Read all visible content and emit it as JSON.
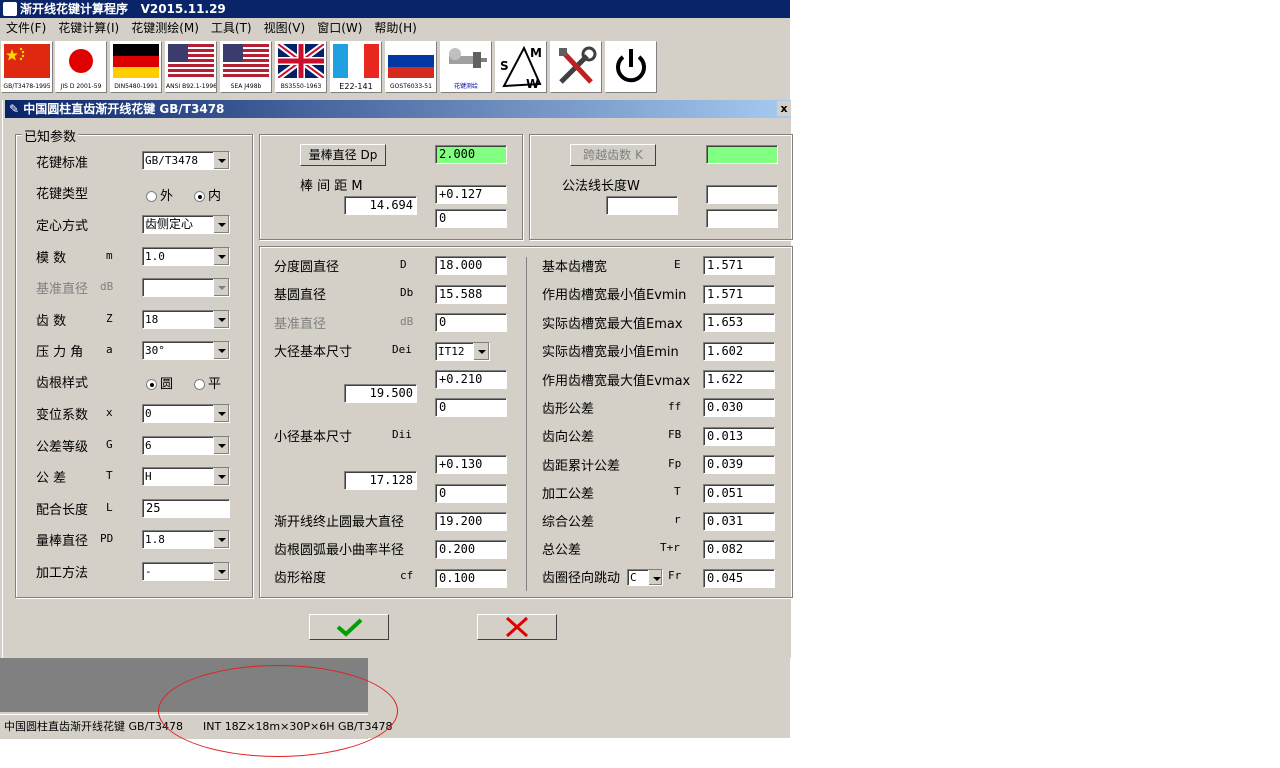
{
  "app": {
    "title": "渐开线花键计算程序",
    "version": "V2015.11.29"
  },
  "menu": [
    "文件(F)",
    "花键计算(I)",
    "花键测绘(M)",
    "工具(T)",
    "视图(V)",
    "窗口(W)",
    "帮助(H)"
  ],
  "toolbar": [
    {
      "icon": "china-flag-icon",
      "caption": "GB/T3478-1995"
    },
    {
      "icon": "japan-flag-icon",
      "caption": "JIS D 2001-59"
    },
    {
      "icon": "germany-flag-icon",
      "caption": "DIN5480-1991"
    },
    {
      "icon": "usa-flag-icon",
      "caption": "ANSI B92.1-1996"
    },
    {
      "icon": "usa-flag-icon",
      "caption": "SEA J498b"
    },
    {
      "icon": "uk-flag-icon",
      "caption": "BS3550-1963"
    },
    {
      "icon": "france-flag-icon",
      "caption": "E22-141"
    },
    {
      "icon": "russia-flag-icon",
      "caption": "GOST6033-51"
    },
    {
      "icon": "spline-measure-icon",
      "caption": "花键测绘"
    },
    {
      "icon": "smw-icon",
      "caption": ""
    },
    {
      "icon": "tools-icon",
      "caption": ""
    },
    {
      "icon": "power-icon",
      "caption": ""
    }
  ],
  "window": {
    "title": "中国圆柱直齿渐开线花键  GB/T3478",
    "close": "x"
  },
  "known": {
    "legend": "已知参数",
    "standard": {
      "label": "花键标准",
      "value": "GB/T3478"
    },
    "type": {
      "label": "花键类型",
      "opt1": "外",
      "opt2": "内",
      "selected": "内"
    },
    "centering": {
      "label": "定心方式",
      "value": "齿侧定心"
    },
    "module": {
      "label": "模    数",
      "sym": "m",
      "value": "1.0"
    },
    "base_dia": {
      "label": "基准直径",
      "sym": "dB",
      "value": ""
    },
    "teeth": {
      "label": "齿    数",
      "sym": "Z",
      "value": "18"
    },
    "pressure": {
      "label": "压 力 角",
      "sym": "a",
      "value": "30°"
    },
    "root": {
      "label": "齿根样式",
      "opt1": "圆",
      "opt2": "平",
      "selected": "圆"
    },
    "shift": {
      "label": "变位系数",
      "sym": "x",
      "value": "0"
    },
    "grade": {
      "label": "公差等级",
      "sym": "G",
      "value": "6"
    },
    "tolerance": {
      "label": "公    差",
      "sym": "T",
      "value": "H"
    },
    "length": {
      "label": "配合长度",
      "sym": "L",
      "value": "25"
    },
    "pin": {
      "label": "量棒直径",
      "sym": "PD",
      "value": "1.8"
    },
    "method": {
      "label": "加工方法",
      "value": "-"
    }
  },
  "pin_box": {
    "button": "量棒直径 Dp",
    "dp_value": "2.000",
    "distance_label": "棒 间 距  M",
    "m_value": "14.694",
    "upper": "+0.127",
    "lower": "0"
  },
  "span_box": {
    "button": "跨越齿数  K",
    "k_value": "",
    "w_label": "公法线长度W",
    "w_value": "",
    "upper": "",
    "lower": ""
  },
  "left_results": [
    {
      "label": "分度圆直径",
      "sym": "D",
      "value": "18.000"
    },
    {
      "label": "基圆直径",
      "sym": "Db",
      "value": "15.588"
    },
    {
      "label": "基准直径",
      "sym": "dB",
      "value": "0"
    }
  ],
  "major": {
    "label": "大径基本尺寸",
    "sym": "Dei",
    "grade": "IT12",
    "value": "19.500",
    "upper": "+0.210",
    "lower": "0"
  },
  "minor": {
    "label": "小径基本尺寸",
    "sym": "Dii",
    "value": "17.128",
    "upper": "+0.130",
    "lower": "0"
  },
  "left_bottom": [
    {
      "label": "渐开线终止圆最大直径",
      "sym": "",
      "value": "19.200"
    },
    {
      "label": "齿根圆弧最小曲率半径",
      "sym": "",
      "value": "0.200"
    },
    {
      "label": "齿形裕度",
      "sym": "cf",
      "value": "0.100"
    }
  ],
  "right_results": [
    {
      "label": "基本齿槽宽",
      "sym": "E",
      "value": "1.571"
    },
    {
      "label": "作用齿槽宽最小值Evmin",
      "sym": "",
      "value": "1.571"
    },
    {
      "label": "实际齿槽宽最大值Emax",
      "sym": "",
      "value": "1.653"
    },
    {
      "label": "实际齿槽宽最小值Emin",
      "sym": "",
      "value": "1.602"
    },
    {
      "label": "作用齿槽宽最大值Evmax",
      "sym": "",
      "value": "1.622"
    },
    {
      "label": "齿形公差",
      "sym": "ff",
      "value": "0.030"
    },
    {
      "label": "齿向公差",
      "sym": "FB",
      "value": "0.013"
    },
    {
      "label": "齿距累计公差",
      "sym": "Fp",
      "value": "0.039"
    },
    {
      "label": "加工公差",
      "sym": "T",
      "value": "0.051"
    },
    {
      "label": "综合公差",
      "sym": "r",
      "value": "0.031"
    },
    {
      "label": "总公差",
      "sym": "T+r",
      "value": "0.082"
    }
  ],
  "runout": {
    "label": "齿圈径向跳动",
    "combo": "C",
    "sym": "Fr",
    "value": "0.045"
  },
  "colors": {
    "ok": "#00a000",
    "cancel": "#e00000",
    "green_field": "#80ff80"
  },
  "status": {
    "left": "中国圆柱直齿渐开线花键  GB/T3478",
    "right": "INT 18Z×18m×30P×6H GB/T3478"
  }
}
